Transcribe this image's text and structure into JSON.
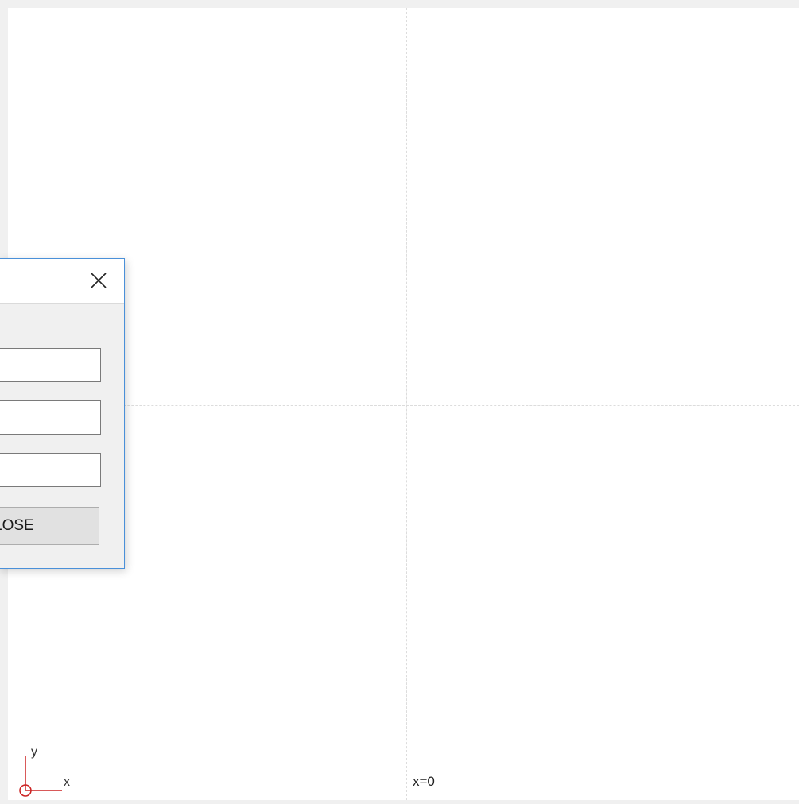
{
  "dialog": {
    "close_icon": "close-icon",
    "fields": [
      {
        "value": "",
        "placeholder": ""
      },
      {
        "value": "",
        "placeholder": ""
      },
      {
        "value": "",
        "placeholder": ""
      }
    ],
    "button_label": "LOSE"
  },
  "viewport": {
    "ucs_x_label": "x",
    "ucs_y_label": "y",
    "coord_readout": "x=0"
  },
  "colors": {
    "ucs_axes": "#cc2222",
    "dialog_border": "#4a90d9",
    "guides": "#dcdcdc"
  }
}
